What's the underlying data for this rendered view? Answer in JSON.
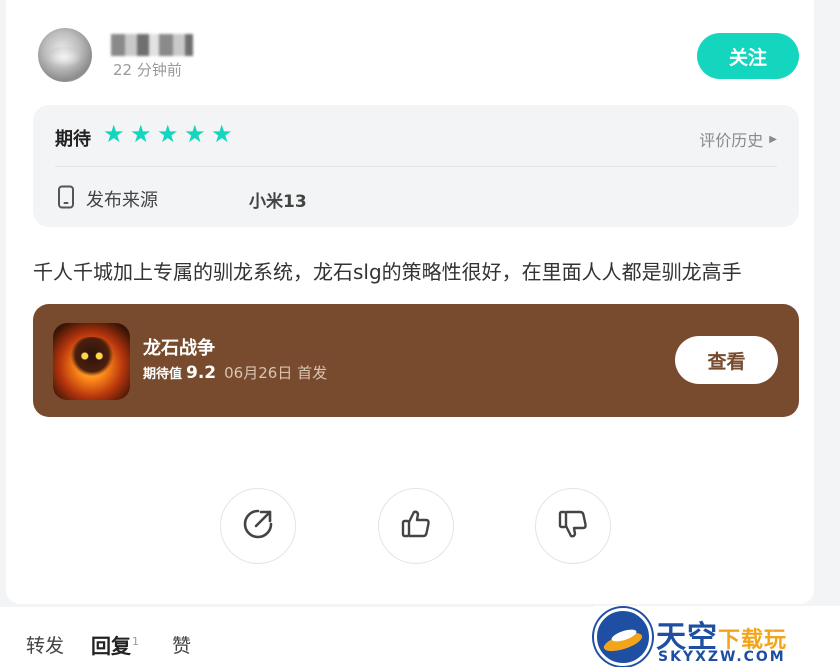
{
  "header": {
    "post_time": "22 分钟前",
    "follow_label": "关注"
  },
  "rating": {
    "label": "期待",
    "stars": 5,
    "history_label": "评价历史",
    "source_label": "发布来源",
    "source_value": "小米13",
    "accent_color": "#14d5bd"
  },
  "review": {
    "text": "千人千城加上专属的驯龙系统，龙石slg的策略性很好，在里面人人都是驯龙高手"
  },
  "game": {
    "name": "龙石战争",
    "expect_label": "期待值",
    "expect_score": "9.2",
    "release_info": "06月26日 首发",
    "view_label": "查看",
    "card_color": "#784b2f"
  },
  "bottom_tabs": {
    "repost": "转发",
    "reply": "回复",
    "reply_count": "1",
    "like": "赞"
  },
  "watermark": {
    "title_main": "天空",
    "title_sub": "下载玩",
    "domain": "SKYXZW.COM"
  }
}
